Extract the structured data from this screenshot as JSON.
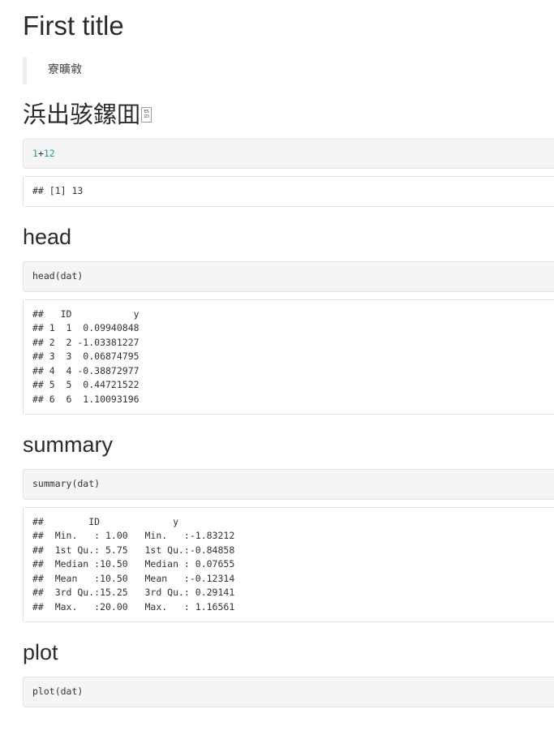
{
  "document": {
    "title": "First title",
    "blockquote": "寮曠敹",
    "cjk_heading": "浜出骇鏍囬",
    "cjk_heading_control_glyph": {
      "line1": "ES",
      "line2": "1D",
      "name": "control-picture-box"
    },
    "accent_number_color": "#1a9e9e",
    "code_input_bg": "#f5f5f5",
    "code_output_bg": "#ffffff",
    "border_color": "#e0e0e0",
    "text_color": "#333333"
  },
  "sections": [
    {
      "id": "intro",
      "heading": null,
      "code_input_parts": [
        {
          "text": "1",
          "kind": "num"
        },
        {
          "text": "+",
          "kind": "op"
        },
        {
          "text": "12",
          "kind": "num"
        }
      ],
      "code_input_plain": "1+12",
      "code_output": "## [1] 13"
    },
    {
      "id": "head",
      "heading": "head",
      "code_input_plain": "head(dat)",
      "code_output": "##   ID           y\n## 1  1  0.09940848\n## 2  2 -1.03381227\n## 3  3  0.06874795\n## 4  4 -0.38872977\n## 5  5  0.44721522\n## 6  6  1.10093196"
    },
    {
      "id": "summary",
      "heading": "summary",
      "code_input_plain": "summary(dat)",
      "code_output": "##        ID             y          \n##  Min.   : 1.00   Min.   :-1.83212  \n##  1st Qu.: 5.75   1st Qu.:-0.84858  \n##  Median :10.50   Median : 0.07655  \n##  Mean   :10.50   Mean   :-0.12314  \n##  3rd Qu.:15.25   3rd Qu.: 0.29141  \n##  Max.   :20.00   Max.   : 1.16561  "
    },
    {
      "id": "plot",
      "heading": "plot",
      "code_input_plain": "plot(dat)",
      "code_output": null
    }
  ]
}
